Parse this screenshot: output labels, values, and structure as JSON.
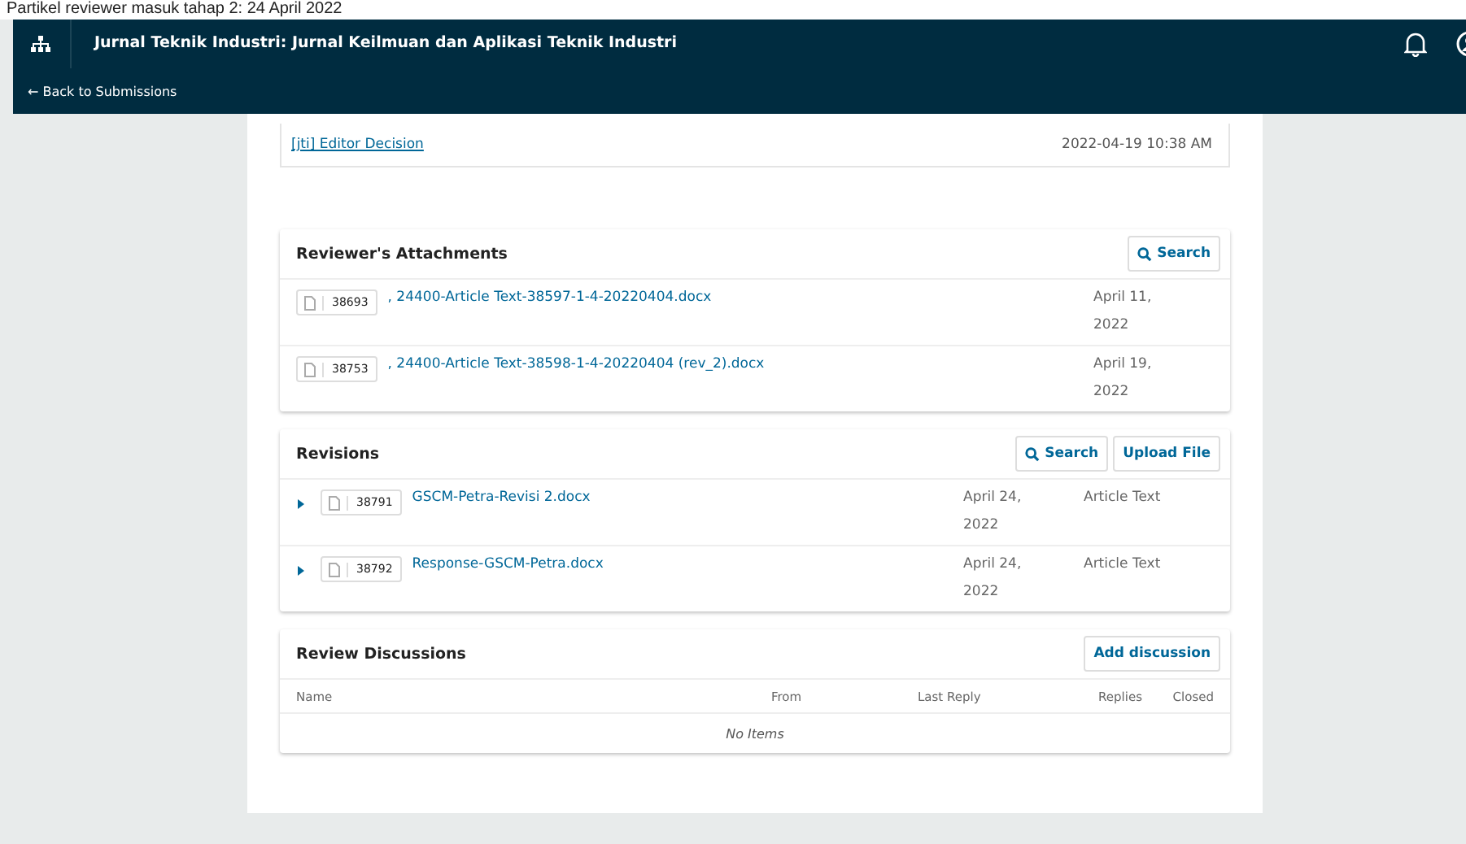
{
  "caption": "Partikel reviewer masuk tahap 2: 24 April 2022",
  "header": {
    "title": "Jurnal Teknik Industri: Jurnal Keilmuan dan Aplikasi Teknik Industri",
    "back_link": "← Back to Submissions"
  },
  "history": [
    {
      "label": "[jti] Editor Decision",
      "date": "2022-04-19 10:38 AM"
    }
  ],
  "attachments": {
    "title": "Reviewer's Attachments",
    "buttons": [
      "Search"
    ],
    "files": [
      {
        "id": "38693",
        "name": ", 24400-Article Text-38597-1-4-20220404.docx",
        "date": "April 11, 2022"
      },
      {
        "id": "38753",
        "name": ", 24400-Article Text-38598-1-4-20220404 (rev_2).docx",
        "date": "April 19, 2022"
      }
    ]
  },
  "revisions": {
    "title": "Revisions",
    "buttons": [
      "Search",
      "Upload File"
    ],
    "files": [
      {
        "id": "38791",
        "name": "GSCM-Petra-Revisi 2.docx",
        "date": "April 24, 2022",
        "type": "Article Text",
        "expanded": false
      },
      {
        "id": "38792",
        "name": "Response-GSCM-Petra.docx",
        "date": "April 24, 2022",
        "type": "Article Text",
        "expanded": false
      }
    ]
  },
  "discussions": {
    "title": "Review Discussions",
    "button": "Add discussion",
    "columns": [
      "Name",
      "From",
      "Last Reply",
      "Replies",
      "Closed"
    ],
    "empty": "No Items"
  }
}
